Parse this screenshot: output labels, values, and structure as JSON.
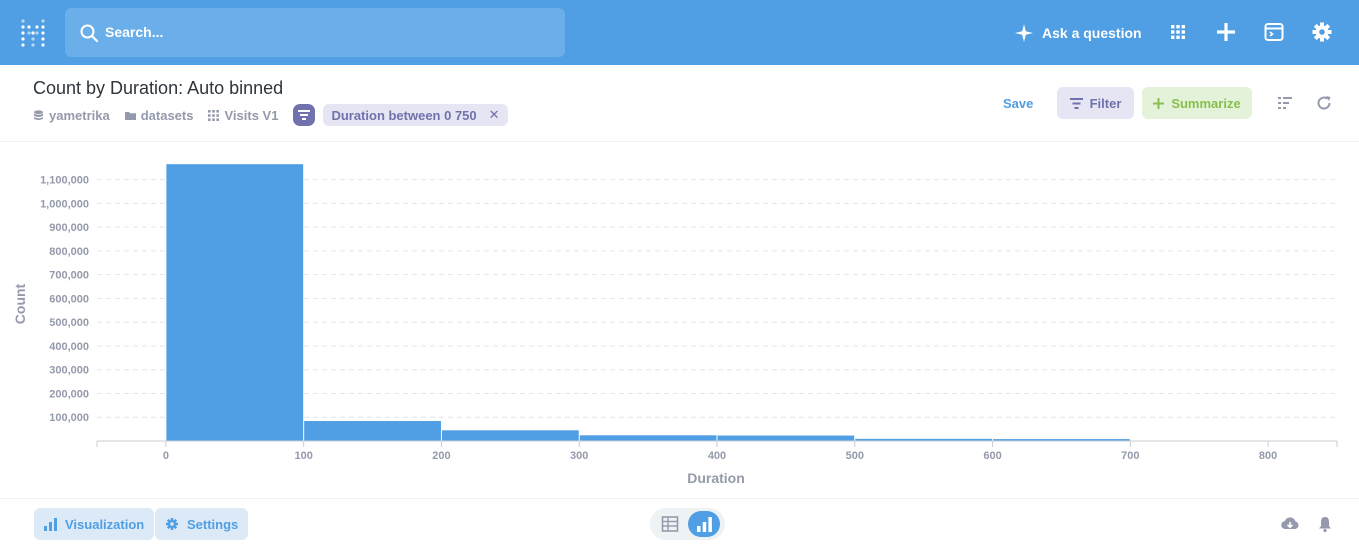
{
  "nav": {
    "search_placeholder": "Search...",
    "ask_label": "Ask a question"
  },
  "header": {
    "title": "Count by Duration: Auto binned",
    "breadcrumbs": [
      "yametrika",
      "datasets",
      "Visits V1"
    ],
    "filter_pill": "Duration between 0 750",
    "save_label": "Save",
    "filter_label": "Filter",
    "summarize_label": "Summarize"
  },
  "footer": {
    "visualization_label": "Visualization",
    "settings_label": "Settings"
  },
  "colors": {
    "brand": "#509ee3",
    "filter": "#7172ad",
    "summarize": "#88bf4d"
  },
  "chart_data": {
    "type": "bar",
    "xlabel": "Duration",
    "ylabel": "Count",
    "x_ticks": [
      0,
      100,
      200,
      300,
      400,
      500,
      600,
      700,
      800
    ],
    "y_ticks": [
      100000,
      200000,
      300000,
      400000,
      500000,
      600000,
      700000,
      800000,
      900000,
      1000000,
      1100000
    ],
    "xlim": [
      -50,
      850
    ],
    "ylim": [
      0,
      1170000
    ],
    "bins": [
      {
        "start": 0,
        "end": 100,
        "value": 1165000
      },
      {
        "start": 100,
        "end": 200,
        "value": 84000
      },
      {
        "start": 200,
        "end": 300,
        "value": 45000
      },
      {
        "start": 300,
        "end": 400,
        "value": 24000
      },
      {
        "start": 400,
        "end": 500,
        "value": 23000
      },
      {
        "start": 500,
        "end": 600,
        "value": 9000
      },
      {
        "start": 600,
        "end": 700,
        "value": 8000
      }
    ],
    "grid": true,
    "color": "#509ee3"
  }
}
